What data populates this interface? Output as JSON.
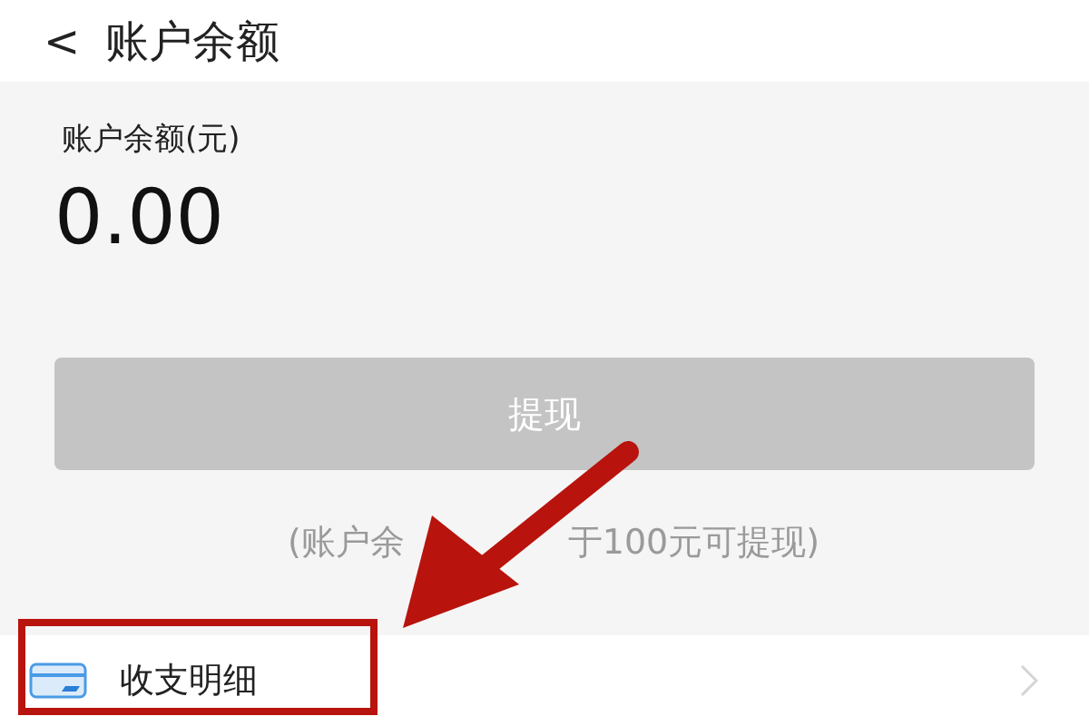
{
  "header": {
    "back": "<",
    "title": "账户余额"
  },
  "balance": {
    "label": "账户余额(元)",
    "amount": "0.00"
  },
  "withdraw_button": {
    "label": "提现",
    "disabled": true
  },
  "hint_parts": [
    "(账户余",
    "于100元可提现)"
  ],
  "list_items": [
    {
      "label": "收支明细"
    }
  ]
}
